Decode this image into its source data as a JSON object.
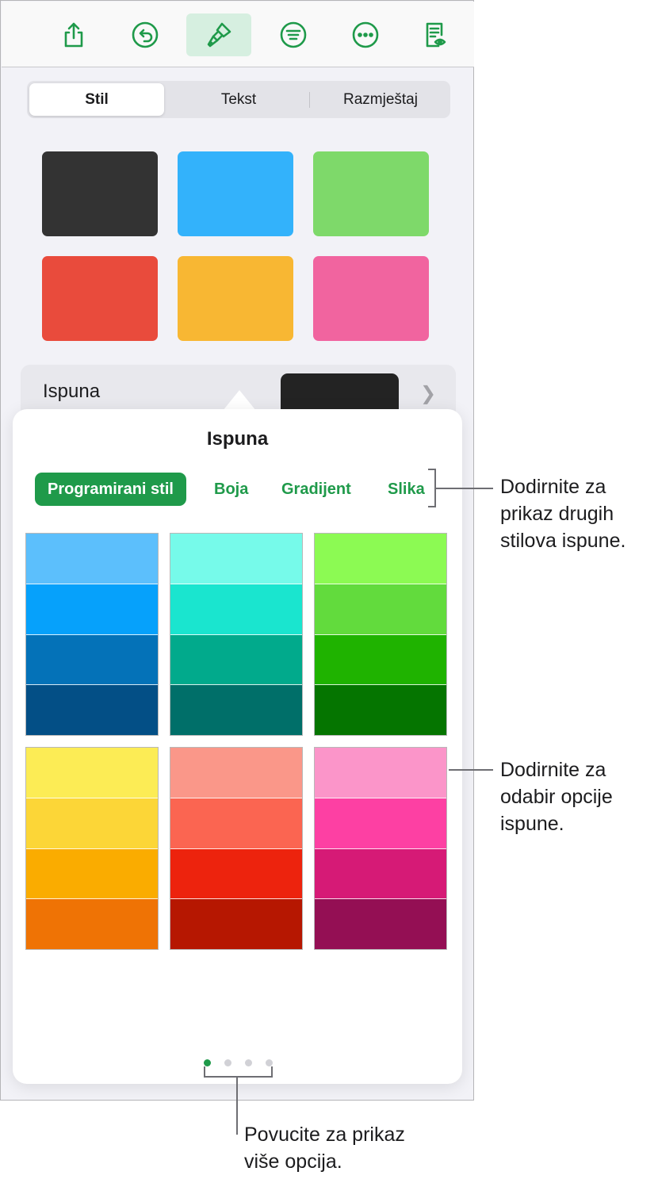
{
  "toolbar": {
    "buttons": [
      {
        "icon": "share-icon"
      },
      {
        "icon": "undo-icon"
      },
      {
        "icon": "paintbrush-icon",
        "active": true
      },
      {
        "icon": "text-format-icon"
      },
      {
        "icon": "more-icon"
      },
      {
        "icon": "document-view-icon"
      }
    ],
    "accent_color": "#1f9a4a"
  },
  "format_tabs": {
    "style": "Stil",
    "text": "Tekst",
    "arrange": "Razmještaj",
    "selected": "Stil"
  },
  "style_swatches": [
    "#333333",
    "#33b2fb",
    "#7ed96a",
    "#e94b3c",
    "#f8b733",
    "#f1649f"
  ],
  "fill_row": {
    "label": "Ispuna",
    "current_color": "#232323"
  },
  "fill_popover": {
    "title": "Ispuna",
    "tabs": {
      "preset": "Programirani stil",
      "color": "Boja",
      "gradient": "Gradijent",
      "image": "Slika",
      "selected": "Programirani stil"
    },
    "palettes": [
      [
        "#5cbffc",
        "#06a1fb",
        "#0472b8",
        "#034f86"
      ],
      [
        "#76faea",
        "#1ae5cf",
        "#01aa8c",
        "#006f69"
      ],
      [
        "#8cfa53",
        "#62db3d",
        "#1fb300",
        "#057500"
      ],
      [
        "#fcec55",
        "#fcd637",
        "#faac00",
        "#ef7305"
      ],
      [
        "#fa9789",
        "#fb6551",
        "#ed230d",
        "#b61701"
      ],
      [
        "#fb95c9",
        "#fd40a3",
        "#d61a76",
        "#940f54"
      ]
    ],
    "page_count": 4,
    "current_page": 1
  },
  "callouts": {
    "tabs_hint": "Dodirnite za\nprikaz drugih\nstilova ispune.",
    "palette_hint": "Dodirnite za\nodabir opcije\nispune.",
    "swipe_hint": "Povucite za prikaz\nviše opcija."
  }
}
